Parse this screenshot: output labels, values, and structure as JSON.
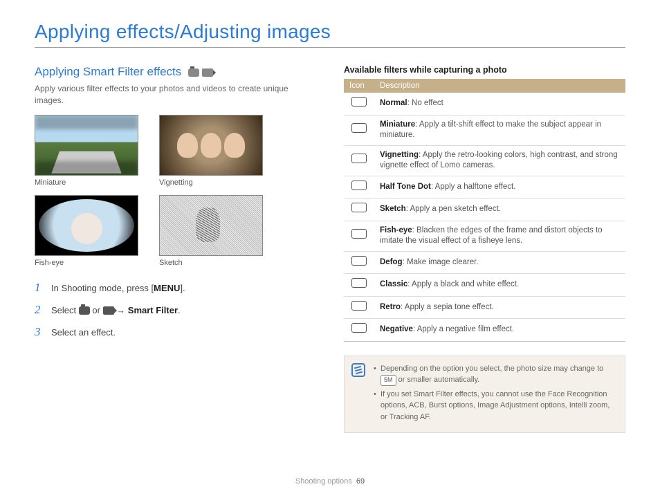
{
  "page": {
    "title": "Applying effects/Adjusting images",
    "footer_section": "Shooting options",
    "footer_page": "69"
  },
  "left": {
    "heading": "Applying Smart Filter effects",
    "subtext": "Apply various filter effects to your photos and videos to create unique images.",
    "samples": [
      {
        "caption": "Miniature"
      },
      {
        "caption": "Vignetting"
      },
      {
        "caption": "Fish-eye"
      },
      {
        "caption": "Sketch"
      }
    ],
    "steps": {
      "s1_pre": "In Shooting mode, press [",
      "s1_menu": "MENU",
      "s1_post": "].",
      "s2_pre": "Select ",
      "s2_or": " or ",
      "s2_arrow": " → ",
      "s2_bold": "Smart Filter",
      "s2_post": ".",
      "s3": "Select an effect."
    }
  },
  "right": {
    "table_title": "Available filters while capturing a photo",
    "headers": {
      "icon": "Icon",
      "desc": "Description"
    },
    "rows": [
      {
        "name": "Normal",
        "desc": ": No effect"
      },
      {
        "name": "Miniature",
        "desc": ": Apply a tilt-shift effect to make the subject appear in miniature."
      },
      {
        "name": "Vignetting",
        "desc": ": Apply the retro-looking colors, high contrast, and strong vignette effect of Lomo cameras."
      },
      {
        "name": "Half Tone Dot",
        "desc": ": Apply a halftone effect."
      },
      {
        "name": "Sketch",
        "desc": ": Apply a pen sketch effect."
      },
      {
        "name": "Fish-eye",
        "desc": ": Blacken the edges of the frame and distort objects to imitate the visual effect of a fisheye lens."
      },
      {
        "name": "Defog",
        "desc": ": Make image clearer."
      },
      {
        "name": "Classic",
        "desc": ": Apply a black and white effect."
      },
      {
        "name": "Retro",
        "desc": ": Apply a sepia tone effect."
      },
      {
        "name": "Negative",
        "desc": ": Apply a negative film effect."
      }
    ],
    "note": {
      "bullet1_pre": "Depending on the option you select, the photo size may change to ",
      "bullet1_badge": "5M",
      "bullet1_post": " or smaller automatically.",
      "bullet2": "If you set Smart Filter effects, you cannot use the Face Recognition options, ACB, Burst options, Image Adjustment options, Intelli zoom, or Tracking AF."
    }
  }
}
